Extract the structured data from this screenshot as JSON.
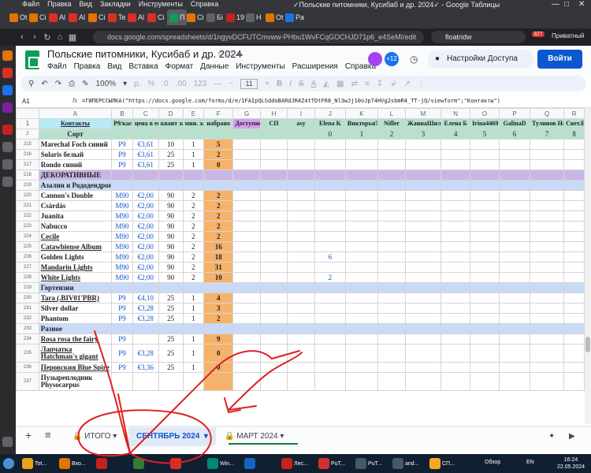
{
  "browser": {
    "menu": [
      "Файл",
      "Правка",
      "Вид",
      "Закладки",
      "Инструменты",
      "Справка"
    ],
    "window_title": "✓Польские питомники, Кусибаб и др. 2024✓ - Google Таблицы",
    "tabs": [
      {
        "label": "Ot",
        "color": "#e37400"
      },
      {
        "label": "Ci",
        "color": "#e37400"
      },
      {
        "label": "Al",
        "color": "#d93025"
      },
      {
        "label": "Al",
        "color": "#d93025"
      },
      {
        "label": "Ci",
        "color": "#e37400"
      },
      {
        "label": "Te",
        "color": "#d93025"
      },
      {
        "label": "Al",
        "color": "#d93025"
      },
      {
        "label": "Ci",
        "color": "#d93025"
      },
      {
        "label": "П",
        "color": "#0f9d58"
      },
      {
        "label": "Ci",
        "color": "#e37400"
      },
      {
        "label": "Бi",
        "color": "#5f6368"
      },
      {
        "label": "19",
        "color": "#c5221f"
      },
      {
        "label": "Н",
        "color": "#5f6368"
      },
      {
        "label": "Ot",
        "color": "#e37400"
      },
      {
        "label": "Pa",
        "color": "#1a73e8"
      }
    ],
    "url": "docs.google.com/spreadsheets/d/1ngyvDCFUTCmvww-PHbu1WvFCqGOCHJD71p6_e4SeMI/edit",
    "search": "floatridw",
    "badge": "327",
    "private_label": "Приватный"
  },
  "sheets": {
    "title": "Польские питомники, Кусибаб и др. 2024",
    "menus": [
      "Файл",
      "Правка",
      "Вид",
      "Вставка",
      "Формат",
      "Данные",
      "Инструменты",
      "Расширения",
      "Справка"
    ],
    "collab_count": "+12",
    "access_label": "Настройки Доступа",
    "login_label": "Войти",
    "zoom": "100%",
    "font_size": "11",
    "cell_ref": "A1",
    "formula": "=ГИПЕРССЫЛКА(\"https://docs.google.com/forms/d/e/1FAIpQLSddoBARdJR4Z4tTDtFR8_Nl3wJj10oJp74HVg2sbmR4_TT-jQ/viewform\";\"Контакты\")"
  },
  "grid": {
    "columns": [
      "",
      "A",
      "B",
      "C",
      "D",
      "E",
      "F",
      "G",
      "H",
      "I",
      "J",
      "K",
      "L",
      "M",
      "N",
      "O",
      "P",
      "Q",
      "R"
    ],
    "header1": {
      "rn": "1",
      "A": "Контакты",
      "B": "Р9/кассета",
      "C": "цена в евро с орг",
      "D": "квант заказа",
      "E": "мин. заказ",
      "F": "набрано",
      "G": "Доступно к заказу",
      "H": "СП",
      "I": "asy",
      "J": "Elena K",
      "K": "Викторья7",
      "L": "Nifler",
      "M": "ЖаннаШиляева",
      "N": "Елена Б",
      "O": "Irina4469",
      "P": "GalinaD",
      "Q": "Тулинов Николай",
      "R": "Свет.Е"
    },
    "header2": {
      "rn": "2",
      "A": "Сорт",
      "J": "0",
      "K": "1",
      "L": "2",
      "M": "3",
      "N": "4",
      "O": "5",
      "P": "6",
      "Q": "7",
      "R": "8"
    },
    "rows": [
      {
        "rn": "215",
        "A": "Marechal Foch синий",
        "B": "P9",
        "C": "€3,61",
        "D": "10",
        "E": "1",
        "F": "5"
      },
      {
        "rn": "216",
        "A": "Solaris белый",
        "B": "P9",
        "C": "€3,61",
        "D": "25",
        "E": "1",
        "F": "2"
      },
      {
        "rn": "217",
        "A": "Rondo синий",
        "B": "P9",
        "C": "€3,61",
        "D": "25",
        "E": "1",
        "F": "0"
      },
      {
        "rn": "218",
        "A": "ДЕКОРАТИВНЫЕ",
        "section": "purple"
      },
      {
        "rn": "219",
        "A": "Азалии и Рододендроны",
        "section": "blue"
      },
      {
        "rn": "220",
        "A": "Cannon's Double",
        "B": "M90",
        "C": "€2,00",
        "D": "90",
        "E": "2",
        "F": "2"
      },
      {
        "rn": "221",
        "A": "Csárdás",
        "B": "M90",
        "C": "€2,00",
        "D": "90",
        "E": "2",
        "F": "2"
      },
      {
        "rn": "222",
        "A": "Juanita",
        "B": "M90",
        "C": "€2,00",
        "D": "90",
        "E": "2",
        "F": "2"
      },
      {
        "rn": "223",
        "A": "Nabucco",
        "B": "M90",
        "C": "€2,00",
        "D": "90",
        "E": "2",
        "F": "2"
      },
      {
        "rn": "224",
        "A": "Cecile",
        "B": "M90",
        "C": "€2,00",
        "D": "90",
        "E": "2",
        "F": "2"
      },
      {
        "rn": "225",
        "A": "Catawbiense Album",
        "B": "M90",
        "C": "€2,00",
        "D": "90",
        "E": "2",
        "F": "16"
      },
      {
        "rn": "226",
        "A": "Golden Lights",
        "B": "M90",
        "C": "€2,00",
        "D": "90",
        "E": "2",
        "F": "18",
        "J": "6"
      },
      {
        "rn": "227",
        "A": "Mandarin Lights",
        "B": "M90",
        "C": "€2,00",
        "D": "90",
        "E": "2",
        "F": "31"
      },
      {
        "rn": "228",
        "A": "White Lights",
        "B": "M90",
        "C": "€2,00",
        "D": "90",
        "E": "2",
        "F": "10",
        "J": "2"
      },
      {
        "rn": "229",
        "A": "Гортензии",
        "section": "blue"
      },
      {
        "rn": "230",
        "A": "Tara (.BIV01'PBR)",
        "B": "P9",
        "C": "€4,10",
        "D": "25",
        "E": "1",
        "F": "4"
      },
      {
        "rn": "231",
        "A": "Silver dollar",
        "B": "P9",
        "C": "€3,28",
        "D": "25",
        "E": "1",
        "F": "3"
      },
      {
        "rn": "232",
        "A": "Phantom",
        "B": "P9",
        "C": "€3,28",
        "D": "25",
        "E": "1",
        "F": "2"
      },
      {
        "rn": "233",
        "A": "Разное",
        "section": "blue"
      },
      {
        "rn": "234",
        "A": "Rosa rosa the fairy",
        "B": "P9",
        "C": "",
        "D": "25",
        "E": "1",
        "F": "9"
      },
      {
        "rn": "235",
        "A": "Лапчатка Hatchman's gigant",
        "B": "P9",
        "C": "€3,28",
        "D": "25",
        "E": "1",
        "F": "0",
        "tall": true
      },
      {
        "rn": "236",
        "A": "Перовския Blue Spire",
        "B": "P9",
        "C": "€3,36",
        "D": "25",
        "E": "1",
        "F": "0"
      },
      {
        "rn": "237",
        "A": "Пузыреплодник Physocarpus",
        "tall": true
      }
    ]
  },
  "sheet_tabs": {
    "add": "+",
    "list": "≡",
    "tab1": "ИТОГО",
    "tab2": "СЕНТЯБРЬ 2024",
    "tab3": "МАРТ 2024"
  },
  "taskbar": {
    "items": [
      "Tot...",
      "Вхо...",
      "",
      "",
      "",
      "Win...",
      "",
      "Лес...",
      "PuT...",
      "PuT...",
      "and...",
      "СП..."
    ],
    "lang": "EN",
    "tray": "Обзор",
    "time": "16:24",
    "date": "22.05.2024"
  },
  "colors": {
    "tabstrip": "#35363a",
    "header_green": "#b7e1cd",
    "contacts_cyan": "#b8e9f7",
    "available_magenta": "#d99ef1",
    "section_purple": "#c9b6e6",
    "section_blue": "#c9daf8",
    "collected_orange": "#f6b26b",
    "annotation_red": "#e02020"
  }
}
